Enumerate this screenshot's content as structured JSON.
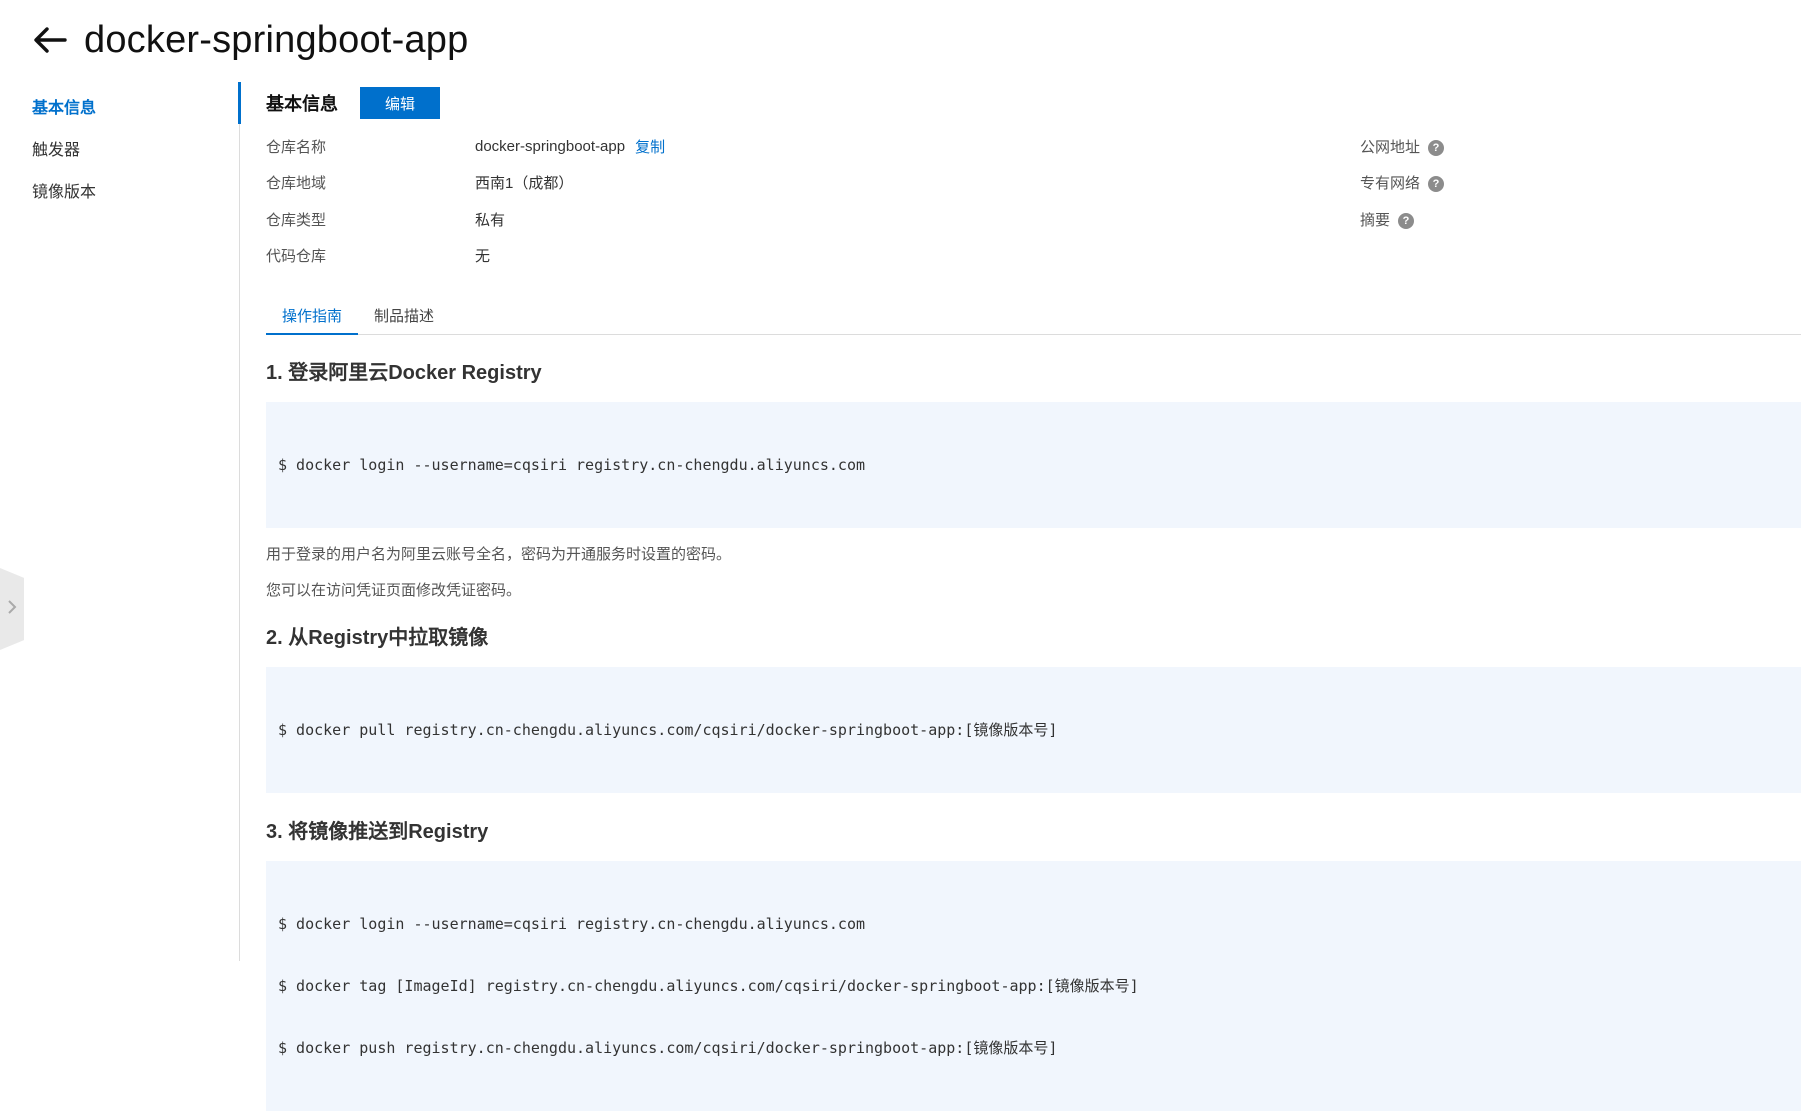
{
  "header": {
    "title": "docker-springboot-app"
  },
  "sidebar": {
    "items": [
      {
        "label": "基本信息"
      },
      {
        "label": "触发器"
      },
      {
        "label": "镜像版本"
      }
    ]
  },
  "basic_info": {
    "section_title": "基本信息",
    "edit_label": "编辑",
    "rows": [
      {
        "label": "仓库名称",
        "value": "docker-springboot-app",
        "action": "复制"
      },
      {
        "label": "仓库地域",
        "value": "西南1（成都）"
      },
      {
        "label": "仓库类型",
        "value": "私有"
      },
      {
        "label": "代码仓库",
        "value": "无"
      }
    ],
    "right_rows": [
      {
        "label": "公网地址",
        "icon": "help-icon"
      },
      {
        "label": "专有网络",
        "icon": "help-icon"
      },
      {
        "label": "摘要",
        "icon": "help-icon"
      }
    ]
  },
  "tabs": [
    {
      "label": "操作指南",
      "active": true
    },
    {
      "label": "制品描述",
      "active": false
    }
  ],
  "guide": {
    "step1": {
      "title": "1. 登录阿里云Docker Registry",
      "code": [
        "$ docker login --username=cqsiri registry.cn-chengdu.aliyuncs.com"
      ],
      "notes": [
        "用于登录的用户名为阿里云账号全名，密码为开通服务时设置的密码。",
        "您可以在访问凭证页面修改凭证密码。"
      ]
    },
    "step2": {
      "title": "2. 从Registry中拉取镜像",
      "code": [
        "$ docker pull registry.cn-chengdu.aliyuncs.com/cqsiri/docker-springboot-app:[镜像版本号]"
      ]
    },
    "step3": {
      "title": "3. 将镜像推送到Registry",
      "code": [
        "$ docker login --username=cqsiri registry.cn-chengdu.aliyuncs.com",
        "$ docker tag [ImageId] registry.cn-chengdu.aliyuncs.com/cqsiri/docker-springboot-app:[镜像版本号]",
        "$ docker push registry.cn-chengdu.aliyuncs.com/cqsiri/docker-springboot-app:[镜像版本号]"
      ]
    }
  },
  "colors": {
    "accent": "#0070cc",
    "code_bg": "#f1f6fd"
  }
}
